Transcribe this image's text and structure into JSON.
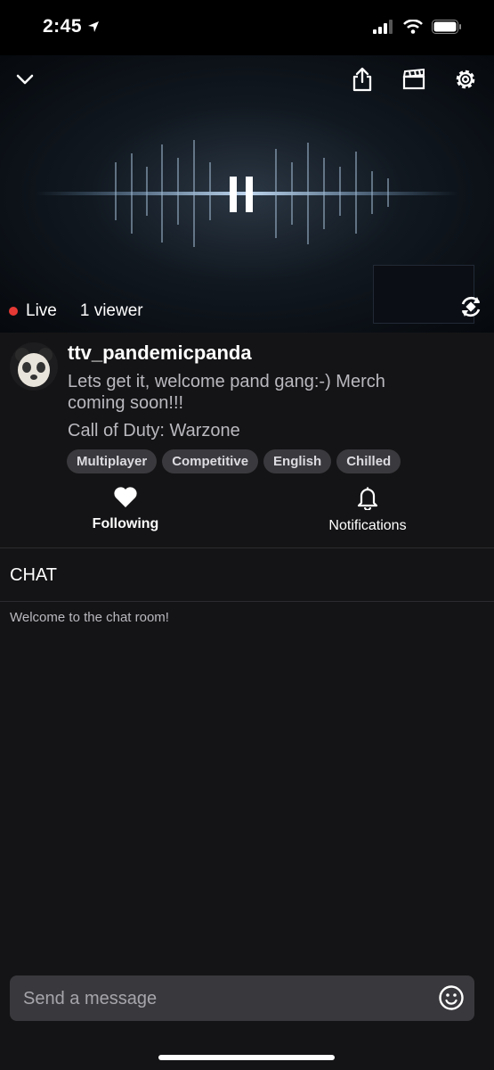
{
  "status": {
    "time": "2:45"
  },
  "stream": {
    "live_label": "Live",
    "viewers": "1 viewer",
    "streamer": "ttv_pandemicpanda",
    "title": "Lets get it, welcome pand gang:-) Merch coming soon!!!",
    "game": "Call of Duty: Warzone",
    "tags": [
      "Multiplayer",
      "Competitive",
      "English",
      "Chilled"
    ]
  },
  "actions": {
    "following": "Following",
    "notifications": "Notifications"
  },
  "chat": {
    "title": "CHAT",
    "welcome": "Welcome to the chat room!",
    "placeholder": "Send a message"
  },
  "colors": {
    "live_dot": "#e53935",
    "background": "#141416",
    "tag_bg": "#3a3a3e"
  }
}
